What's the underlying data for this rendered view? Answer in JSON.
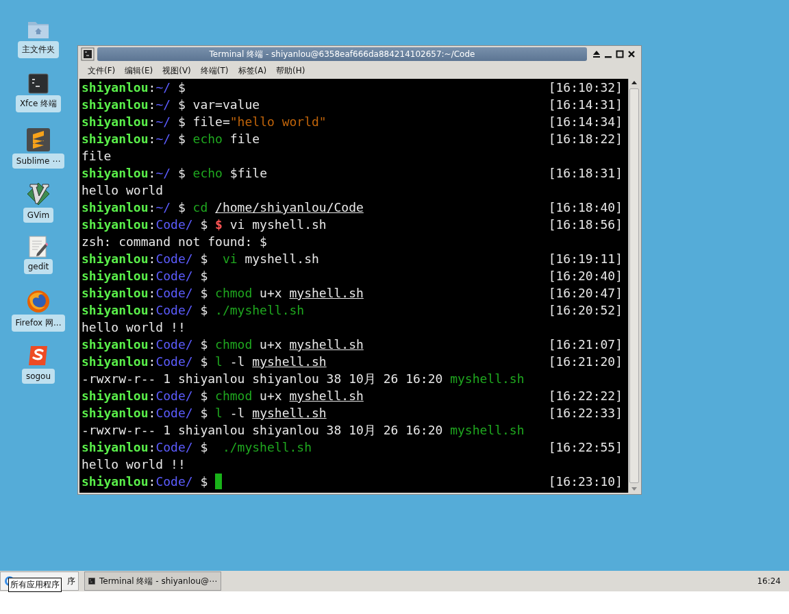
{
  "desktop_icons": [
    {
      "label": "主文件夹",
      "kind": "folder"
    },
    {
      "label": "Xfce 终端",
      "kind": "terminal"
    },
    {
      "label": "Sublime ⋯",
      "kind": "sublime"
    },
    {
      "label": "GVim",
      "kind": "vim"
    },
    {
      "label": "gedit",
      "kind": "editor"
    },
    {
      "label": "Firefox 网...",
      "kind": "browser"
    },
    {
      "label": "sogou",
      "kind": "sogou"
    }
  ],
  "window": {
    "title": "Terminal 终端 - shiyanlou@6358eaf666da884214102657:~/Code"
  },
  "menu": [
    "文件(F)",
    "编辑(E)",
    "视图(V)",
    "终端(T)",
    "标签(A)",
    "帮助(H)"
  ],
  "terminal_lines": [
    {
      "segments": [
        {
          "kind": "user",
          "text": "shiyanlou"
        },
        {
          "kind": "text",
          "text": ":"
        },
        {
          "kind": "dir",
          "text": "~/"
        },
        {
          "kind": "text",
          "text": " $"
        }
      ],
      "time": "[16:10:32]",
      "cursor": false
    },
    {
      "segments": [
        {
          "kind": "user",
          "text": "shiyanlou"
        },
        {
          "kind": "text",
          "text": ":"
        },
        {
          "kind": "dir",
          "text": "~/"
        },
        {
          "kind": "text",
          "text": " $ var=value"
        }
      ],
      "time": "[16:14:31]",
      "cursor": false
    },
    {
      "segments": [
        {
          "kind": "user",
          "text": "shiyanlou"
        },
        {
          "kind": "text",
          "text": ":"
        },
        {
          "kind": "dir",
          "text": "~/"
        },
        {
          "kind": "text",
          "text": " $ file="
        },
        {
          "kind": "string",
          "text": "\"hello world\""
        }
      ],
      "time": "[16:14:34]",
      "cursor": false
    },
    {
      "segments": [
        {
          "kind": "user",
          "text": "shiyanlou"
        },
        {
          "kind": "text",
          "text": ":"
        },
        {
          "kind": "dir",
          "text": "~/"
        },
        {
          "kind": "text",
          "text": " $ "
        },
        {
          "kind": "command",
          "text": "echo"
        },
        {
          "kind": "text",
          "text": " file"
        }
      ],
      "time": "[16:18:22]",
      "cursor": false
    },
    {
      "segments": [
        {
          "kind": "text",
          "text": "file"
        }
      ],
      "cursor": false
    },
    {
      "segments": [
        {
          "kind": "user",
          "text": "shiyanlou"
        },
        {
          "kind": "text",
          "text": ":"
        },
        {
          "kind": "dir",
          "text": "~/"
        },
        {
          "kind": "text",
          "text": " $ "
        },
        {
          "kind": "command",
          "text": "echo"
        },
        {
          "kind": "text",
          "text": " $file"
        }
      ],
      "time": "[16:18:31]",
      "cursor": false
    },
    {
      "segments": [
        {
          "kind": "text",
          "text": "hello world"
        }
      ],
      "cursor": false
    },
    {
      "segments": [
        {
          "kind": "user",
          "text": "shiyanlou"
        },
        {
          "kind": "text",
          "text": ":"
        },
        {
          "kind": "dir",
          "text": "~/"
        },
        {
          "kind": "text",
          "text": " $ "
        },
        {
          "kind": "command",
          "text": "cd "
        },
        {
          "kind": "path",
          "text": "/home/shiyanlou/Code"
        }
      ],
      "time": "[16:18:40]",
      "cursor": false
    },
    {
      "segments": [
        {
          "kind": "user",
          "text": "shiyanlou"
        },
        {
          "kind": "text",
          "text": ":"
        },
        {
          "kind": "dir",
          "text": "Code/"
        },
        {
          "kind": "text",
          "text": " $ "
        },
        {
          "kind": "error",
          "text": "$"
        },
        {
          "kind": "text",
          "text": " vi myshell.sh"
        }
      ],
      "time": "[16:18:56]",
      "cursor": false
    },
    {
      "segments": [
        {
          "kind": "text",
          "text": "zsh: command not found: $"
        }
      ],
      "cursor": false
    },
    {
      "segments": [
        {
          "kind": "user",
          "text": "shiyanlou"
        },
        {
          "kind": "text",
          "text": ":"
        },
        {
          "kind": "dir",
          "text": "Code/"
        },
        {
          "kind": "text",
          "text": " $  "
        },
        {
          "kind": "command",
          "text": "vi"
        },
        {
          "kind": "text",
          "text": " myshell.sh"
        }
      ],
      "time": "[16:19:11]",
      "cursor": false
    },
    {
      "segments": [
        {
          "kind": "user",
          "text": "shiyanlou"
        },
        {
          "kind": "text",
          "text": ":"
        },
        {
          "kind": "dir",
          "text": "Code/"
        },
        {
          "kind": "text",
          "text": " $"
        }
      ],
      "time": "[16:20:40]",
      "cursor": false
    },
    {
      "segments": [
        {
          "kind": "user",
          "text": "shiyanlou"
        },
        {
          "kind": "text",
          "text": ":"
        },
        {
          "kind": "dir",
          "text": "Code/"
        },
        {
          "kind": "text",
          "text": " $ "
        },
        {
          "kind": "command",
          "text": "chmod"
        },
        {
          "kind": "text",
          "text": " u+x "
        },
        {
          "kind": "path",
          "text": "myshell.sh"
        }
      ],
      "time": "[16:20:47]",
      "cursor": false
    },
    {
      "segments": [
        {
          "kind": "user",
          "text": "shiyanlou"
        },
        {
          "kind": "text",
          "text": ":"
        },
        {
          "kind": "dir",
          "text": "Code/"
        },
        {
          "kind": "text",
          "text": " $ "
        },
        {
          "kind": "command",
          "text": "./myshell.sh"
        }
      ],
      "time": "[16:20:52]",
      "cursor": false
    },
    {
      "segments": [
        {
          "kind": "text",
          "text": "hello world !!"
        }
      ],
      "cursor": false
    },
    {
      "segments": [
        {
          "kind": "user",
          "text": "shiyanlou"
        },
        {
          "kind": "text",
          "text": ":"
        },
        {
          "kind": "dir",
          "text": "Code/"
        },
        {
          "kind": "text",
          "text": " $ "
        },
        {
          "kind": "command",
          "text": "chmod"
        },
        {
          "kind": "text",
          "text": " u+x "
        },
        {
          "kind": "path",
          "text": "myshell.sh"
        }
      ],
      "time": "[16:21:07]",
      "cursor": false
    },
    {
      "segments": [
        {
          "kind": "user",
          "text": "shiyanlou"
        },
        {
          "kind": "text",
          "text": ":"
        },
        {
          "kind": "dir",
          "text": "Code/"
        },
        {
          "kind": "text",
          "text": " $ "
        },
        {
          "kind": "command",
          "text": "l"
        },
        {
          "kind": "text",
          "text": " -l "
        },
        {
          "kind": "path",
          "text": "myshell.sh"
        }
      ],
      "time": "[16:21:20]",
      "cursor": false
    },
    {
      "segments": [
        {
          "kind": "text",
          "text": "-rwxrw-r-- 1 shiyanlou shiyanlou 38 10月 26 16:20 "
        },
        {
          "kind": "command",
          "text": "myshell.sh"
        }
      ],
      "cursor": false
    },
    {
      "segments": [
        {
          "kind": "user",
          "text": "shiyanlou"
        },
        {
          "kind": "text",
          "text": ":"
        },
        {
          "kind": "dir",
          "text": "Code/"
        },
        {
          "kind": "text",
          "text": " $ "
        },
        {
          "kind": "command",
          "text": "chmod"
        },
        {
          "kind": "text",
          "text": " u+x "
        },
        {
          "kind": "path",
          "text": "myshell.sh"
        }
      ],
      "time": "[16:22:22]",
      "cursor": false
    },
    {
      "segments": [
        {
          "kind": "user",
          "text": "shiyanlou"
        },
        {
          "kind": "text",
          "text": ":"
        },
        {
          "kind": "dir",
          "text": "Code/"
        },
        {
          "kind": "text",
          "text": " $ "
        },
        {
          "kind": "command",
          "text": "l"
        },
        {
          "kind": "text",
          "text": " -l "
        },
        {
          "kind": "path",
          "text": "myshell.sh"
        }
      ],
      "time": "[16:22:33]",
      "cursor": false
    },
    {
      "segments": [
        {
          "kind": "text",
          "text": "-rwxrw-r-- 1 shiyanlou shiyanlou 38 10月 26 16:20 "
        },
        {
          "kind": "command",
          "text": "myshell.sh"
        }
      ],
      "cursor": false
    },
    {
      "segments": [
        {
          "kind": "user",
          "text": "shiyanlou"
        },
        {
          "kind": "text",
          "text": ":"
        },
        {
          "kind": "dir",
          "text": "Code/"
        },
        {
          "kind": "text",
          "text": " $  "
        },
        {
          "kind": "command",
          "text": "./myshell.sh"
        }
      ],
      "time": "[16:22:55]",
      "cursor": false
    },
    {
      "segments": [
        {
          "kind": "text",
          "text": "hello world !!"
        }
      ],
      "cursor": false
    },
    {
      "segments": [
        {
          "kind": "user",
          "text": "shiyanlou"
        },
        {
          "kind": "text",
          "text": ":"
        },
        {
          "kind": "dir",
          "text": "Code/"
        },
        {
          "kind": "text",
          "text": " $ "
        }
      ],
      "time": "[16:23:10]",
      "cursor": true
    }
  ],
  "taskbar": {
    "start_label": "序",
    "tooltip": "所有应用程序",
    "task": "Terminal 终端 - shiyanlou@⋯",
    "clock": "16:24"
  }
}
